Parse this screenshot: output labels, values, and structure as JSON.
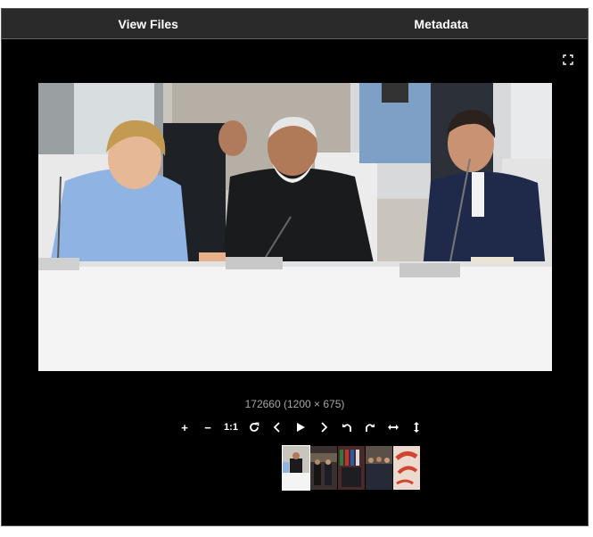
{
  "tabs": [
    {
      "label": "View Files"
    },
    {
      "label": "Metadata"
    }
  ],
  "viewer": {
    "caption": "172660 (1200 × 675)",
    "toolbar": {
      "zoom_in": "+",
      "zoom_out": "−",
      "one_to_one": "1:1"
    }
  },
  "colors": {
    "background": "#000000",
    "tab_bar": "#2a2a2a",
    "caption_text": "#a6a6a6"
  }
}
